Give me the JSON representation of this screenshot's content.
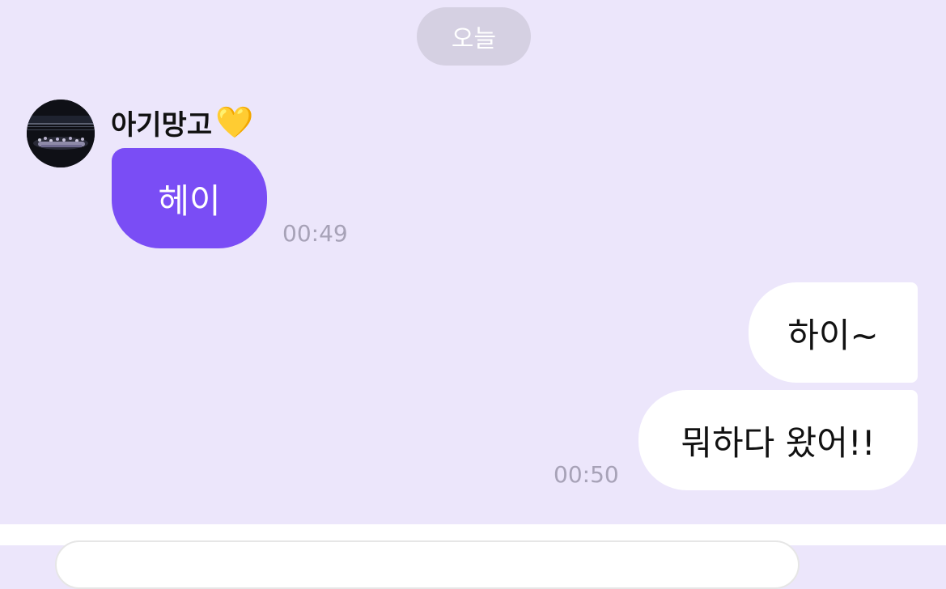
{
  "chat": {
    "date_divider": "오늘",
    "messages": [
      {
        "direction": "incoming",
        "sender": "아기망고",
        "text": "헤이",
        "time": "00:49"
      },
      {
        "direction": "outgoing",
        "text": "하이~"
      },
      {
        "direction": "outgoing",
        "text": "뭐하다 왔어!!",
        "time": "00:50"
      }
    ]
  },
  "sender": {
    "emoji": "💛",
    "avatar_icon": "group-photo-avatar-icon"
  },
  "colors": {
    "background": "#ECE6FB",
    "incoming_bubble": "#7A4DF5",
    "outgoing_bubble": "#FFFFFF",
    "date_pill": "#D5D0E2",
    "timestamp": "#A7A2B7"
  },
  "composer": {
    "placeholder": ""
  }
}
